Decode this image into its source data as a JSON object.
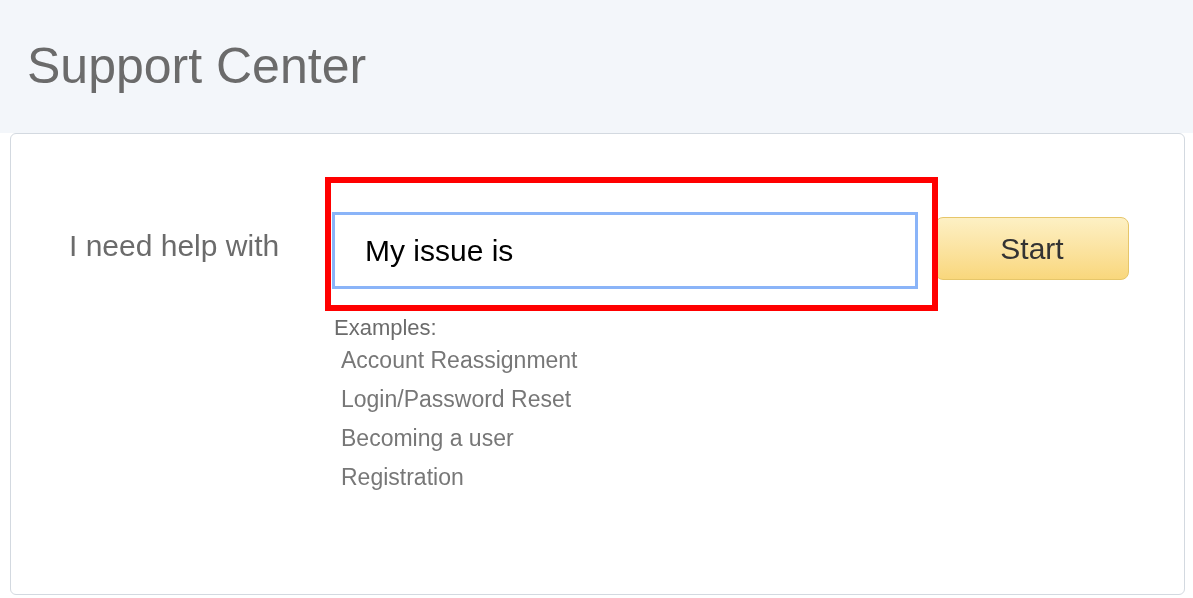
{
  "page": {
    "title": "Support Center"
  },
  "form": {
    "label": "I need help with",
    "input": {
      "value": "My issue is",
      "focused": true
    },
    "button": "Start"
  },
  "examples": {
    "heading": "Examples:",
    "items": [
      "Account Reassignment",
      "Login/Password Reset",
      "Becoming a user",
      "Registration"
    ]
  },
  "annotation": {
    "kind": "highlight",
    "color": "#ff0000"
  }
}
